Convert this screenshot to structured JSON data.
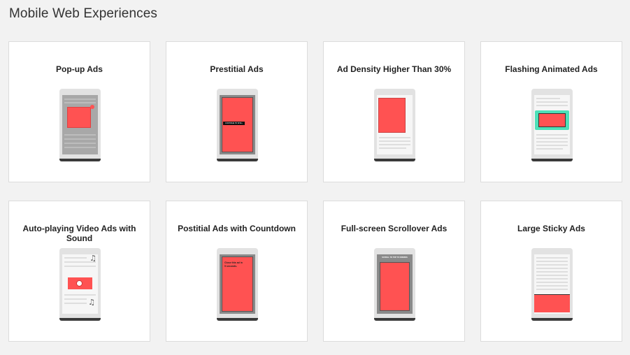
{
  "page": {
    "title": "Mobile Web Experiences"
  },
  "cards": [
    {
      "title": "Pop-up Ads"
    },
    {
      "title": "Prestitial Ads",
      "ad_text": "CONTINUE TO SITE ›"
    },
    {
      "title": "Ad Density Higher Than 30%"
    },
    {
      "title": "Flashing Animated Ads"
    },
    {
      "title": "Auto-playing Video Ads with Sound"
    },
    {
      "title": "Postitial Ads with Countdown",
      "ad_text": "Close this ad in 5 seconds."
    },
    {
      "title": "Full-screen Scrollover Ads",
      "ad_text": "SCROLL TO TOP TO DISMISS"
    },
    {
      "title": "Large Sticky Ads"
    }
  ],
  "colors": {
    "ad_red": "#ff5252",
    "flash_teal": "#4de0b8",
    "overlay_gray": "#9a9a9a"
  },
  "icons": [
    "music-note-icon",
    "speaker-icon",
    "close-icon"
  ]
}
